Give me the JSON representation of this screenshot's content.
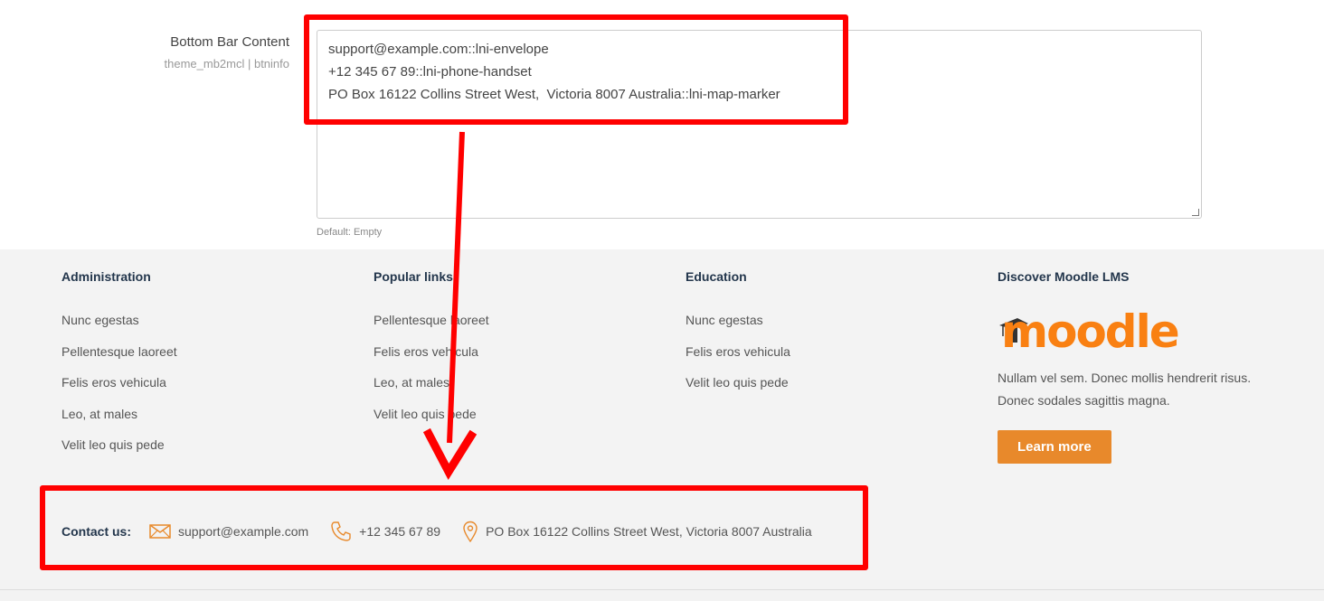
{
  "setting": {
    "title": "Bottom Bar Content",
    "subtitle": "theme_mb2mcl | btninfo",
    "lines": [
      "support@example.com::lni-envelope",
      "+12 345 67 89::lni-phone-handset",
      "PO Box 16122 Collins Street West,  Victoria 8007 Australia::lni-map-marker"
    ],
    "default_note": "Default: Empty"
  },
  "footer": {
    "columns": [
      {
        "title": "Administration",
        "links": [
          "Nunc egestas",
          "Pellentesque laoreet",
          "Felis eros vehicula",
          "Leo, at males",
          "Velit leo quis pede"
        ]
      },
      {
        "title": "Popular links",
        "links": [
          "Pellentesque laoreet",
          "Felis eros vehicula",
          "Leo, at males",
          "Velit leo quis pede"
        ]
      },
      {
        "title": "Education",
        "links": [
          "Nunc egestas",
          "Felis eros vehicula",
          "Velit leo quis pede"
        ]
      }
    ],
    "discover": {
      "title": "Discover Moodle LMS",
      "logo_text": "moodle",
      "description_line1": "Nullam vel sem. Donec mollis hendrerit risus.",
      "description_line2": "Donec sodales sagittis magna.",
      "button": "Learn more"
    },
    "contact": {
      "label": "Contact us:",
      "email": "support@example.com",
      "phone": "+12 345 67 89",
      "address": "PO Box 16122 Collins Street West, Victoria 8007 Australia"
    }
  },
  "colors": {
    "accent": "#e8892b",
    "highlight": "#ff0000",
    "heading": "#23364c"
  },
  "icons": [
    "envelope-icon",
    "phone-icon",
    "map-marker-icon",
    "graduation-cap-icon"
  ]
}
